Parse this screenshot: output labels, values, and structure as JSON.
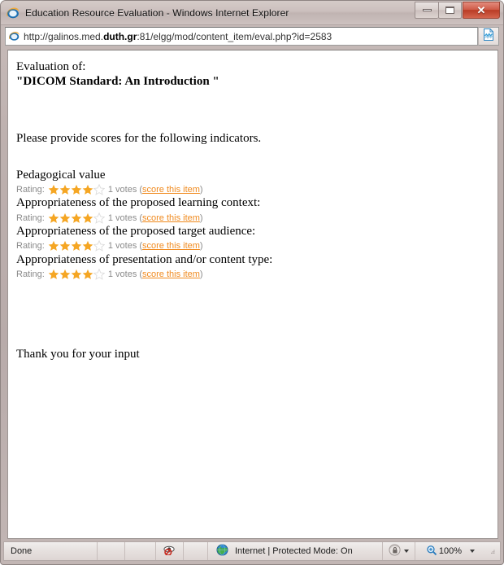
{
  "window": {
    "title": "Education Resource Evaluation - Windows Internet Explorer",
    "app_icon": "internet-explorer-icon",
    "controls": {
      "minimize_label": "",
      "maximize_label": "",
      "close_label": "✕"
    }
  },
  "address_bar": {
    "icon": "internet-explorer-icon",
    "url_prefix": "http://galinos.med.",
    "url_domain": "duth.gr",
    "url_suffix": ":81/elgg/mod/content_item/eval.php?id=2583",
    "url_full": "http://galinos.med.duth.gr:81/elgg/mod/content_item/eval.php?id=2583",
    "compat_icon": "compatibility-view-icon"
  },
  "page": {
    "eval_of_label": "Evaluation of:",
    "resource_title": "\"DICOM Standard: An Introduction \"",
    "instructions": "Please provide scores for the following indicators.",
    "thanks": "Thank you for your input",
    "rating_label": "Rating:",
    "votes_text": "1 votes",
    "score_link_text": "score this item",
    "open_paren": "(",
    "close_paren": ")",
    "star_filled_color": "#f5a623",
    "star_empty_color": "#dfdfdf",
    "link_color": "#f08a1e",
    "indicators": [
      {
        "label": "Pedagogical value",
        "stars_filled": 4,
        "stars_total": 5,
        "votes": "1 votes",
        "link": "score this item"
      },
      {
        "label": "Appropriateness of the proposed learning context:",
        "stars_filled": 4,
        "stars_total": 5,
        "votes": "1 votes",
        "link": "score this item"
      },
      {
        "label": "Appropriateness of the proposed target audience:",
        "stars_filled": 4,
        "stars_total": 5,
        "votes": "1 votes",
        "link": "score this item"
      },
      {
        "label": "Appropriateness of presentation and/or content type:",
        "stars_filled": 4,
        "stars_total": 5,
        "votes": "1 votes",
        "link": "score this item"
      }
    ]
  },
  "status_bar": {
    "status_text": "Done",
    "privacy_icon": "privacy-report-blocked-icon",
    "zone_icon": "internet-zone-globe-icon",
    "zone_text": "Internet | Protected Mode: On",
    "protected_mode_icon": "protected-mode-lock-icon",
    "zoom_icon": "zoom-magnifier-icon",
    "zoom_level": "100%"
  }
}
